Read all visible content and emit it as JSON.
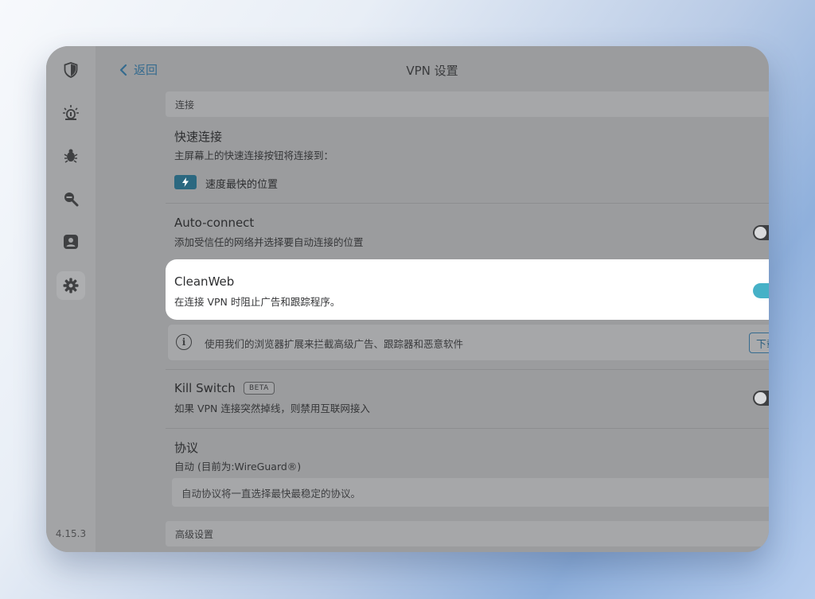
{
  "app": {
    "version": "4.15.3",
    "sidebar_icons": [
      "shield-icon",
      "alert-light-icon",
      "bug-icon",
      "search-icon",
      "user-icon",
      "gear-icon"
    ],
    "active_sidebar": "gear-icon"
  },
  "header": {
    "back_label": "返回",
    "title": "VPN 设置"
  },
  "sections": {
    "connection": "连接",
    "advanced": "高级设置"
  },
  "quick_connect": {
    "title": "快速连接",
    "subtitle": "主屏幕上的快速连接按钮将连接到：",
    "option_label": "速度最快的位置",
    "option_icon": "lightning-icon"
  },
  "auto_connect": {
    "title": "Auto-connect",
    "subtitle": "添加受信任的网络并选择要自动连接的位置",
    "enabled": false
  },
  "cleanweb": {
    "title": "CleanWeb",
    "subtitle": "在连接 VPN 时阻止广告和跟踪程序。",
    "enabled": true
  },
  "extension_info": {
    "text": "使用我们的浏览器扩展来拦截高级广告、跟踪器和恶意软件",
    "button_label": "下载"
  },
  "kill_switch": {
    "title": "Kill Switch",
    "badge": "BETA",
    "subtitle": "如果 VPN 连接突然掉线，则禁用互联网接入",
    "enabled": false
  },
  "protocol": {
    "title": "协议",
    "subtitle": "自动 (目前为:WireGuard®)",
    "note": "自动协议将一直选择最快最稳定的协议。"
  },
  "colors": {
    "accent": "#46b1c7",
    "link": "#356b8f",
    "badge_bg": "#2b6880",
    "overlay": "#9b9c9e"
  }
}
